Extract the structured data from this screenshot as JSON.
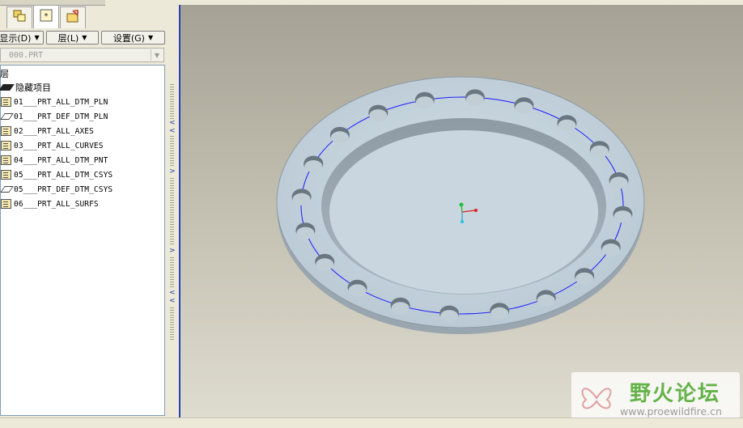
{
  "panel": {
    "display_label": "显示(D)",
    "layer_label": "层(L)",
    "settings_label": "设置(G)",
    "model_value": "000.PRT",
    "tree_root": "层",
    "hidden_items": "隐藏项目",
    "layers": [
      {
        "name": "01___PRT_ALL_DTM_PLN",
        "icon": "layer-stack-icon"
      },
      {
        "name": "01___PRT_DEF_DTM_PLN",
        "icon": "layer-plane-icon"
      },
      {
        "name": "02___PRT_ALL_AXES",
        "icon": "layer-stack-icon"
      },
      {
        "name": "03___PRT_ALL_CURVES",
        "icon": "layer-stack-icon"
      },
      {
        "name": "04___PRT_ALL_DTM_PNT",
        "icon": "layer-stack-icon"
      },
      {
        "name": "05___PRT_ALL_DTM_CSYS",
        "icon": "layer-stack-icon"
      },
      {
        "name": "05___PRT_DEF_DTM_CSYS",
        "icon": "layer-plane-icon"
      },
      {
        "name": "06___PRT_ALL_SURFS",
        "icon": "layer-stack-icon"
      }
    ]
  },
  "watermark": {
    "title": "野火论坛",
    "url": "www.proewildfire.cn"
  },
  "colors": {
    "accent": "#2a41b8",
    "part_fill": "#c6d3dc",
    "circle": "#1a1aff",
    "watermark_green": "#66b24a"
  }
}
